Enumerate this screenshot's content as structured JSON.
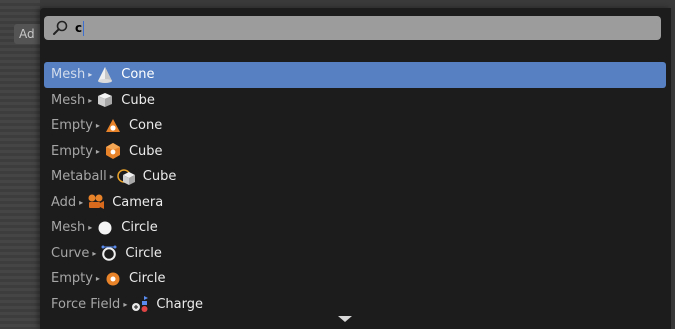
{
  "background": {
    "add_label": "Ad"
  },
  "search": {
    "query": "c",
    "icon": "search-icon"
  },
  "colors": {
    "highlight": "#5680c2",
    "empty_orange": "#e8832a",
    "menu_bg": "#1c1c1c",
    "search_bg": "#9c9c9c"
  },
  "results": [
    {
      "category": "Mesh",
      "name": "Cone",
      "icon": "mesh-cone-icon",
      "active": true
    },
    {
      "category": "Mesh",
      "name": "Cube",
      "icon": "mesh-cube-icon"
    },
    {
      "category": "Empty",
      "name": "Cone",
      "icon": "empty-cone-icon"
    },
    {
      "category": "Empty",
      "name": "Cube",
      "icon": "empty-cube-icon"
    },
    {
      "category": "Metaball",
      "name": "Cube",
      "icon": "metaball-cube-icon"
    },
    {
      "category": "Add",
      "name": "Camera",
      "icon": "camera-icon"
    },
    {
      "category": "Mesh",
      "name": "Circle",
      "icon": "mesh-circle-icon"
    },
    {
      "category": "Curve",
      "name": "Circle",
      "icon": "curve-circle-icon"
    },
    {
      "category": "Empty",
      "name": "Circle",
      "icon": "empty-circle-icon"
    },
    {
      "category": "Force Field",
      "name": "Charge",
      "icon": "force-field-charge-icon"
    }
  ]
}
